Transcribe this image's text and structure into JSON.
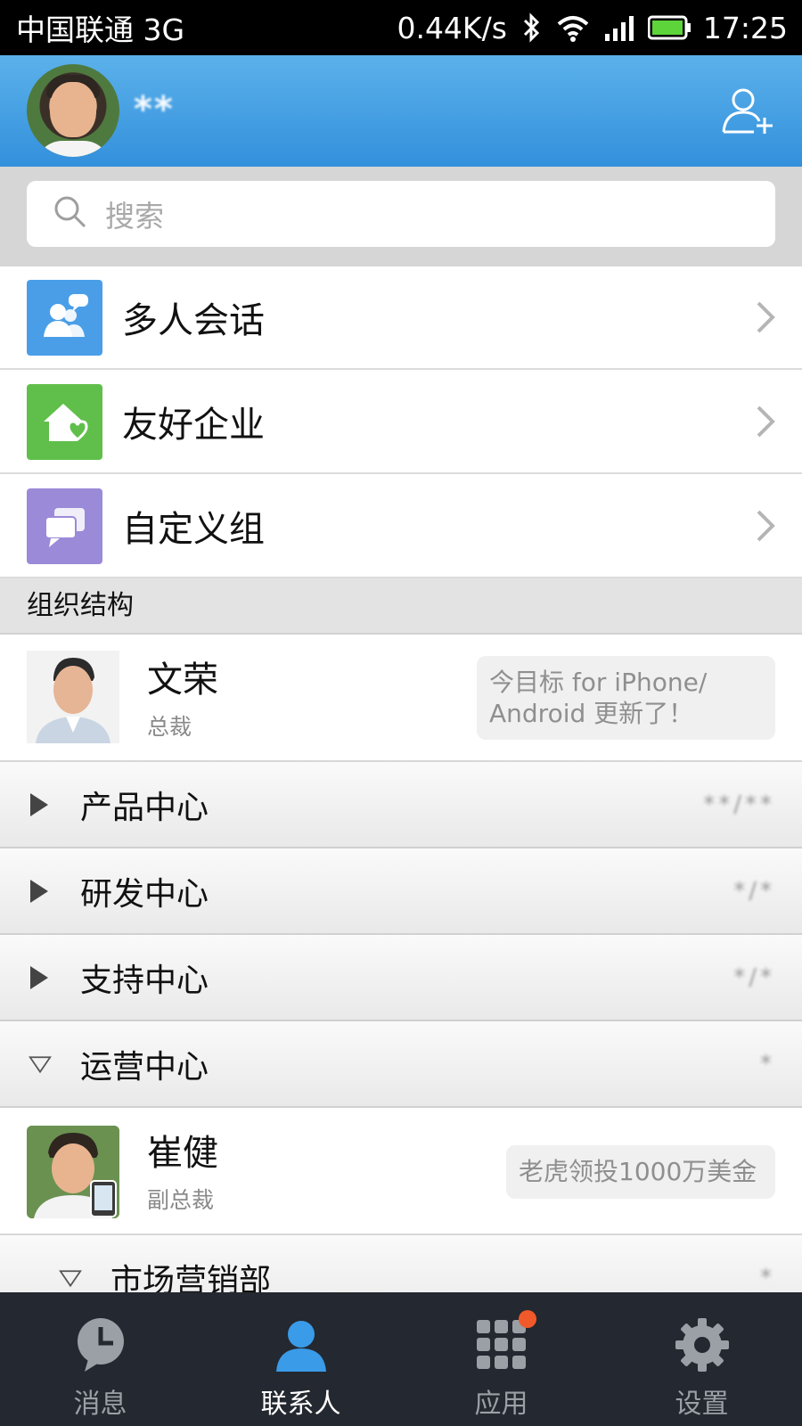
{
  "status_bar": {
    "carrier": "中国联通 3G",
    "speed": "0.44K/s",
    "time": "17:25"
  },
  "header": {
    "username": "**",
    "avatar_icon": "user-avatar",
    "add_contact_icon": "add-user-icon"
  },
  "search": {
    "placeholder": "搜索"
  },
  "features": [
    {
      "label": "多人会话",
      "icon": "group-chat-icon",
      "color": "#4a9ee8"
    },
    {
      "label": "友好企业",
      "icon": "friendly-company-icon",
      "color": "#5fbf4a"
    },
    {
      "label": "自定义组",
      "icon": "custom-group-icon",
      "color": "#9b8ad8"
    }
  ],
  "section": {
    "title": "组织结构"
  },
  "people": [
    {
      "name": "文荣",
      "title": "总裁",
      "status": "今目标 for iPhone/Android 更新了！",
      "status_lines": [
        "今目标 for iPhone/",
        "Android 更新了！"
      ]
    },
    {
      "name": "崔健",
      "title": "副总裁",
      "status": "老虎领投1000万美金"
    }
  ],
  "departments": [
    {
      "label": "产品中心",
      "expanded": false,
      "count": "**/**"
    },
    {
      "label": "研发中心",
      "expanded": false,
      "count": "*/*"
    },
    {
      "label": "支持中心",
      "expanded": false,
      "count": "*/*"
    },
    {
      "label": "运营中心",
      "expanded": true,
      "count": "*"
    },
    {
      "label": "市场营销部",
      "expanded": true,
      "count": "*"
    }
  ],
  "tabs": [
    {
      "label": "消息",
      "icon": "message-clock-icon",
      "active": false
    },
    {
      "label": "联系人",
      "icon": "contacts-icon",
      "active": true
    },
    {
      "label": "应用",
      "icon": "apps-grid-icon",
      "active": false,
      "badge": true
    },
    {
      "label": "设置",
      "icon": "settings-gear-icon",
      "active": false
    }
  ],
  "colors": {
    "header_blue": "#3390dc",
    "tab_bar": "#242830",
    "badge": "#f05a2a"
  }
}
